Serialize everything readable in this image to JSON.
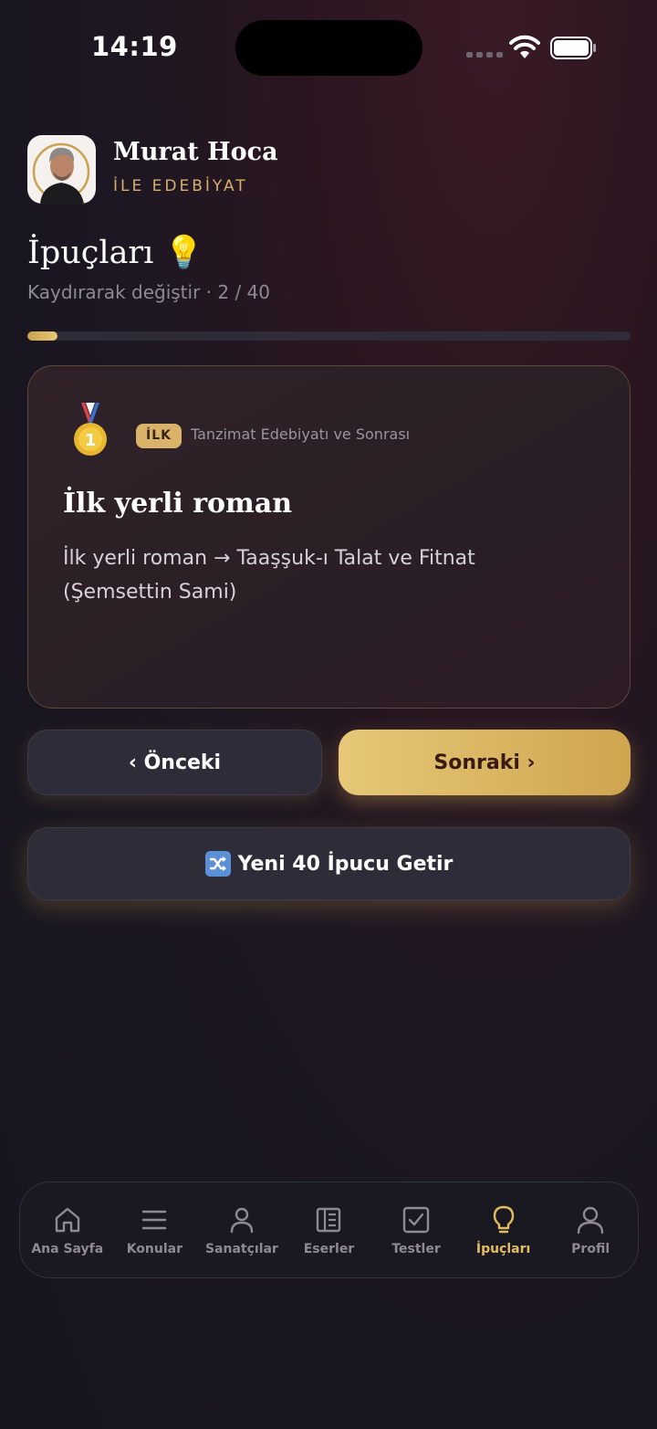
{
  "status": {
    "time": "14:19"
  },
  "header": {
    "title": "Murat Hoca",
    "subtitle": "İLE EDEBİYAT"
  },
  "page": {
    "title": "İpuçları 💡",
    "subtitle": "Kaydırarak değiştir · 2 / 40",
    "progress": 0.05
  },
  "card": {
    "medal_icon": "gold-medal-icon",
    "badge": "İLK",
    "category": "Tanzimat Edebiyatı ve Sonrası",
    "title": "İlk yerli roman",
    "body": "İlk yerli roman → Taaşşuk-ı Talat ve Fitnat (Şemsettin Sami)"
  },
  "buttons": {
    "prev": "‹ Önceki",
    "next": "Sonraki ›",
    "new": "Yeni 40 İpucu Getir"
  },
  "tabs": [
    {
      "label": "Ana Sayfa",
      "icon": "home-icon"
    },
    {
      "label": "Konular",
      "icon": "list-icon"
    },
    {
      "label": "Sanatçılar",
      "icon": "person-icon"
    },
    {
      "label": "Eserler",
      "icon": "book-icon"
    },
    {
      "label": "Testler",
      "icon": "checkbox-icon"
    },
    {
      "label": "İpuçları",
      "icon": "lightbulb-icon",
      "active": true
    },
    {
      "label": "Profil",
      "icon": "profile-icon"
    }
  ],
  "colors": {
    "accent": "#e3bd63",
    "background": "#16151f"
  }
}
